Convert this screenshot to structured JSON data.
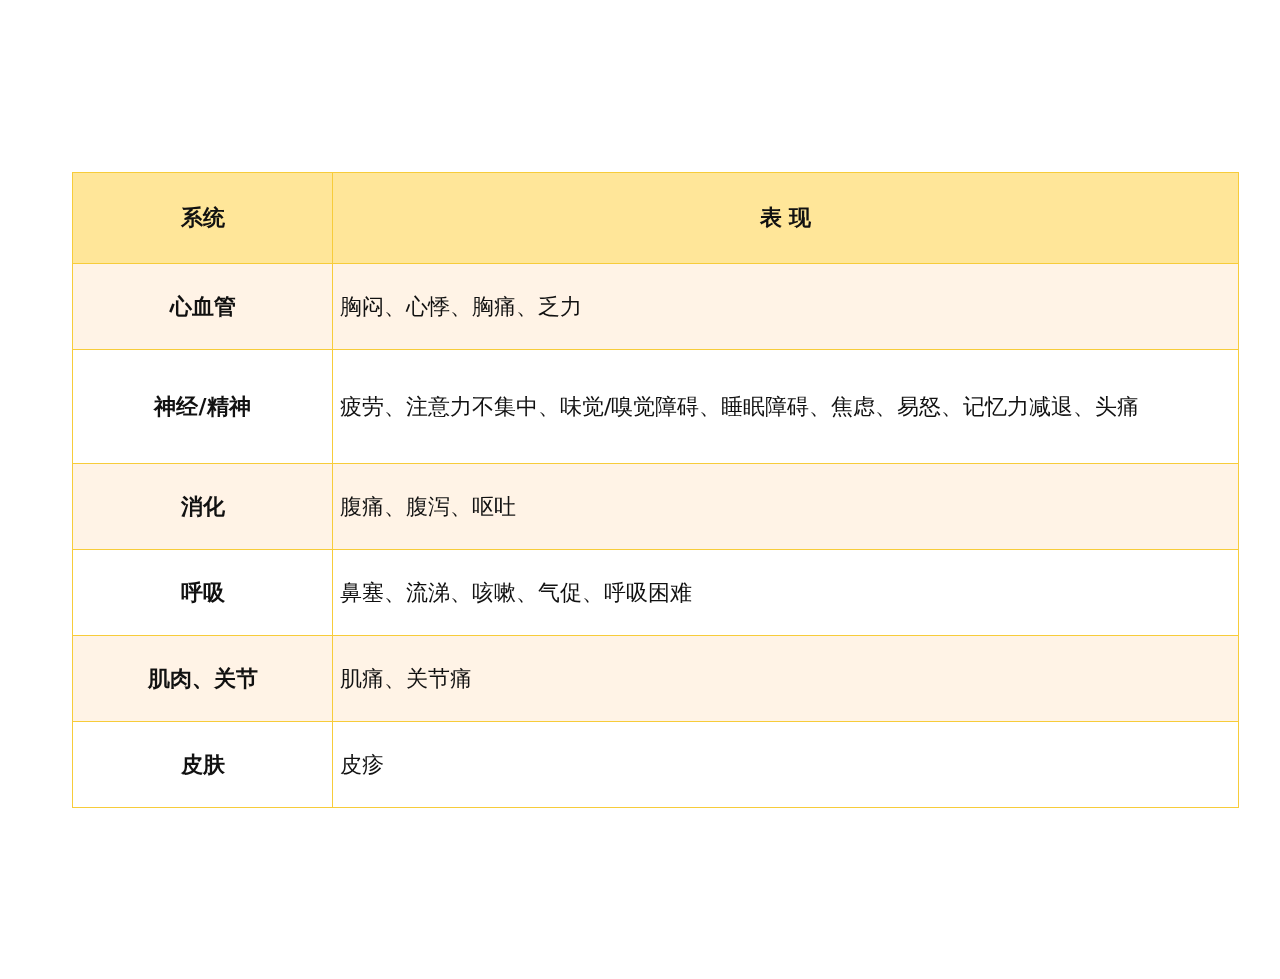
{
  "table": {
    "columns": [
      "系统",
      "表 现"
    ],
    "rows": [
      {
        "system": "心血管",
        "symptoms": "胸闷、心悸、胸痛、乏力"
      },
      {
        "system": "神经/精神",
        "symptoms": "疲劳、注意力不集中、味觉/嗅觉障碍、睡眠障碍、焦虑、易怒、记忆力减退、头痛"
      },
      {
        "system": "消化",
        "symptoms": "腹痛、腹泻、呕吐"
      },
      {
        "system": "呼吸",
        "symptoms": "鼻塞、流涕、咳嗽、气促、呼吸困难"
      },
      {
        "system": "肌肉、关节",
        "symptoms": "肌痛、关节痛"
      },
      {
        "system": "皮肤",
        "symptoms": "皮疹"
      }
    ]
  }
}
